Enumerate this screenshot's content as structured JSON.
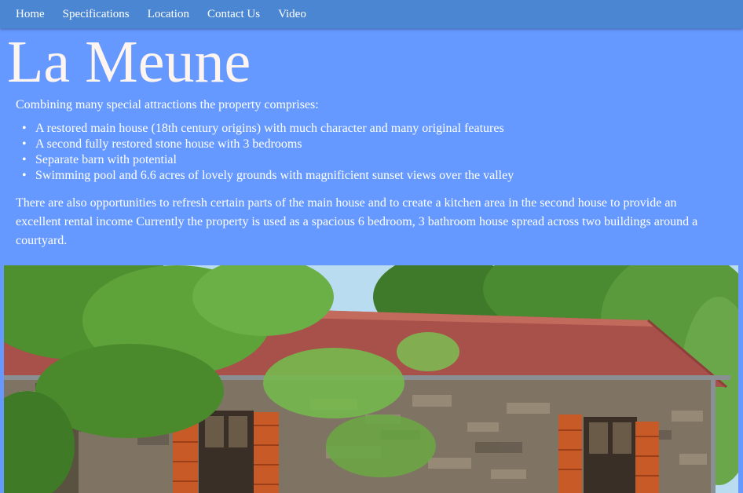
{
  "nav": {
    "items": [
      {
        "label": "Home"
      },
      {
        "label": "Specifications"
      },
      {
        "label": "Location"
      },
      {
        "label": "Contact Us"
      },
      {
        "label": "Video"
      }
    ]
  },
  "page": {
    "title": "La Meune",
    "intro": "Combining many special attractions the property comprises:",
    "features": [
      "A restored main house (18th century origins) with much character and many original features",
      "A second fully restored stone house with 3 bedrooms",
      "Separate barn with potential",
      "Swimming pool and 6.6 acres of lovely grounds with magnificient sunset views over the valley"
    ],
    "description": "There are also opportunities to refresh certain parts of the main house and to create a kitchen area in the second house to provide an excellent rental income Currently the property is used as a spacious 6 bedroom, 3 bathroom house spread across two buildings around a courtyard."
  },
  "colors": {
    "page_background": "#6699ff",
    "navbar_background": "#4b86d2",
    "text": "#ffffff"
  }
}
